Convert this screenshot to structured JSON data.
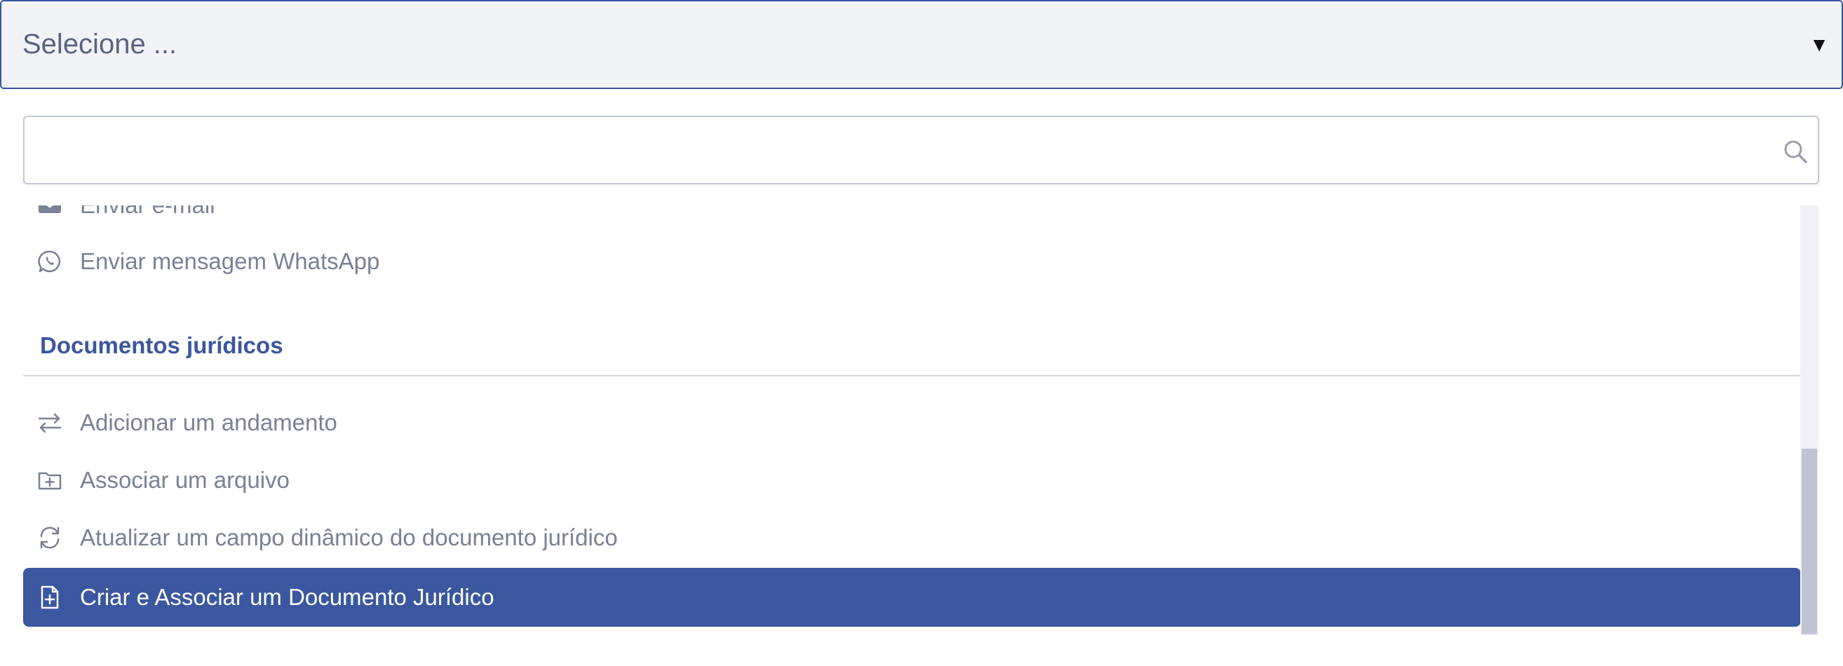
{
  "select": {
    "placeholder": "Selecione ...",
    "arrow": "▼"
  },
  "search": {
    "value": "",
    "placeholder": ""
  },
  "options_top": [
    {
      "label": "Enviar e-mail",
      "icon": "email-icon"
    },
    {
      "label": "Enviar mensagem WhatsApp",
      "icon": "whatsapp-icon"
    }
  ],
  "group": {
    "title": "Documentos jurídicos",
    "items": [
      {
        "label": "Adicionar um andamento",
        "icon": "arrows-exchange-icon"
      },
      {
        "label": "Associar um arquivo",
        "icon": "folder-plus-icon"
      },
      {
        "label": "Atualizar um campo dinâmico do documento jurídico",
        "icon": "refresh-icon"
      },
      {
        "label": "Criar e Associar um Documento Jurídico",
        "icon": "file-plus-icon",
        "active": true
      }
    ]
  },
  "colors": {
    "accent": "#3b57a0",
    "select_bg": "#f2f3f7",
    "option_text": "#7a8196",
    "active_text": "#ffffff",
    "scroll_thumb": "#c0c4d2"
  }
}
